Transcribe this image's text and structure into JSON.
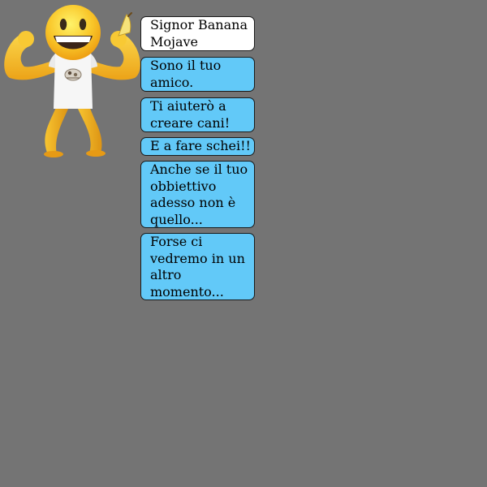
{
  "character": {
    "name": "Signor Banana\nMojave"
  },
  "messages": [
    "Sono il tuo\namico.",
    "Ti aiuterò a\ncreare cani!",
    "E a fare schei!!",
    "Anche se il tuo\nobbiettivo\nadesso non è\nquello...",
    "Forse ci\nvedremo in un\naltro\nmomento..."
  ],
  "colors": {
    "background": "#747474",
    "bubble": "#62c9f8",
    "name_bubble": "#ffffff"
  },
  "icons": {
    "avatar": "muscle-banana-emoji-icon"
  }
}
